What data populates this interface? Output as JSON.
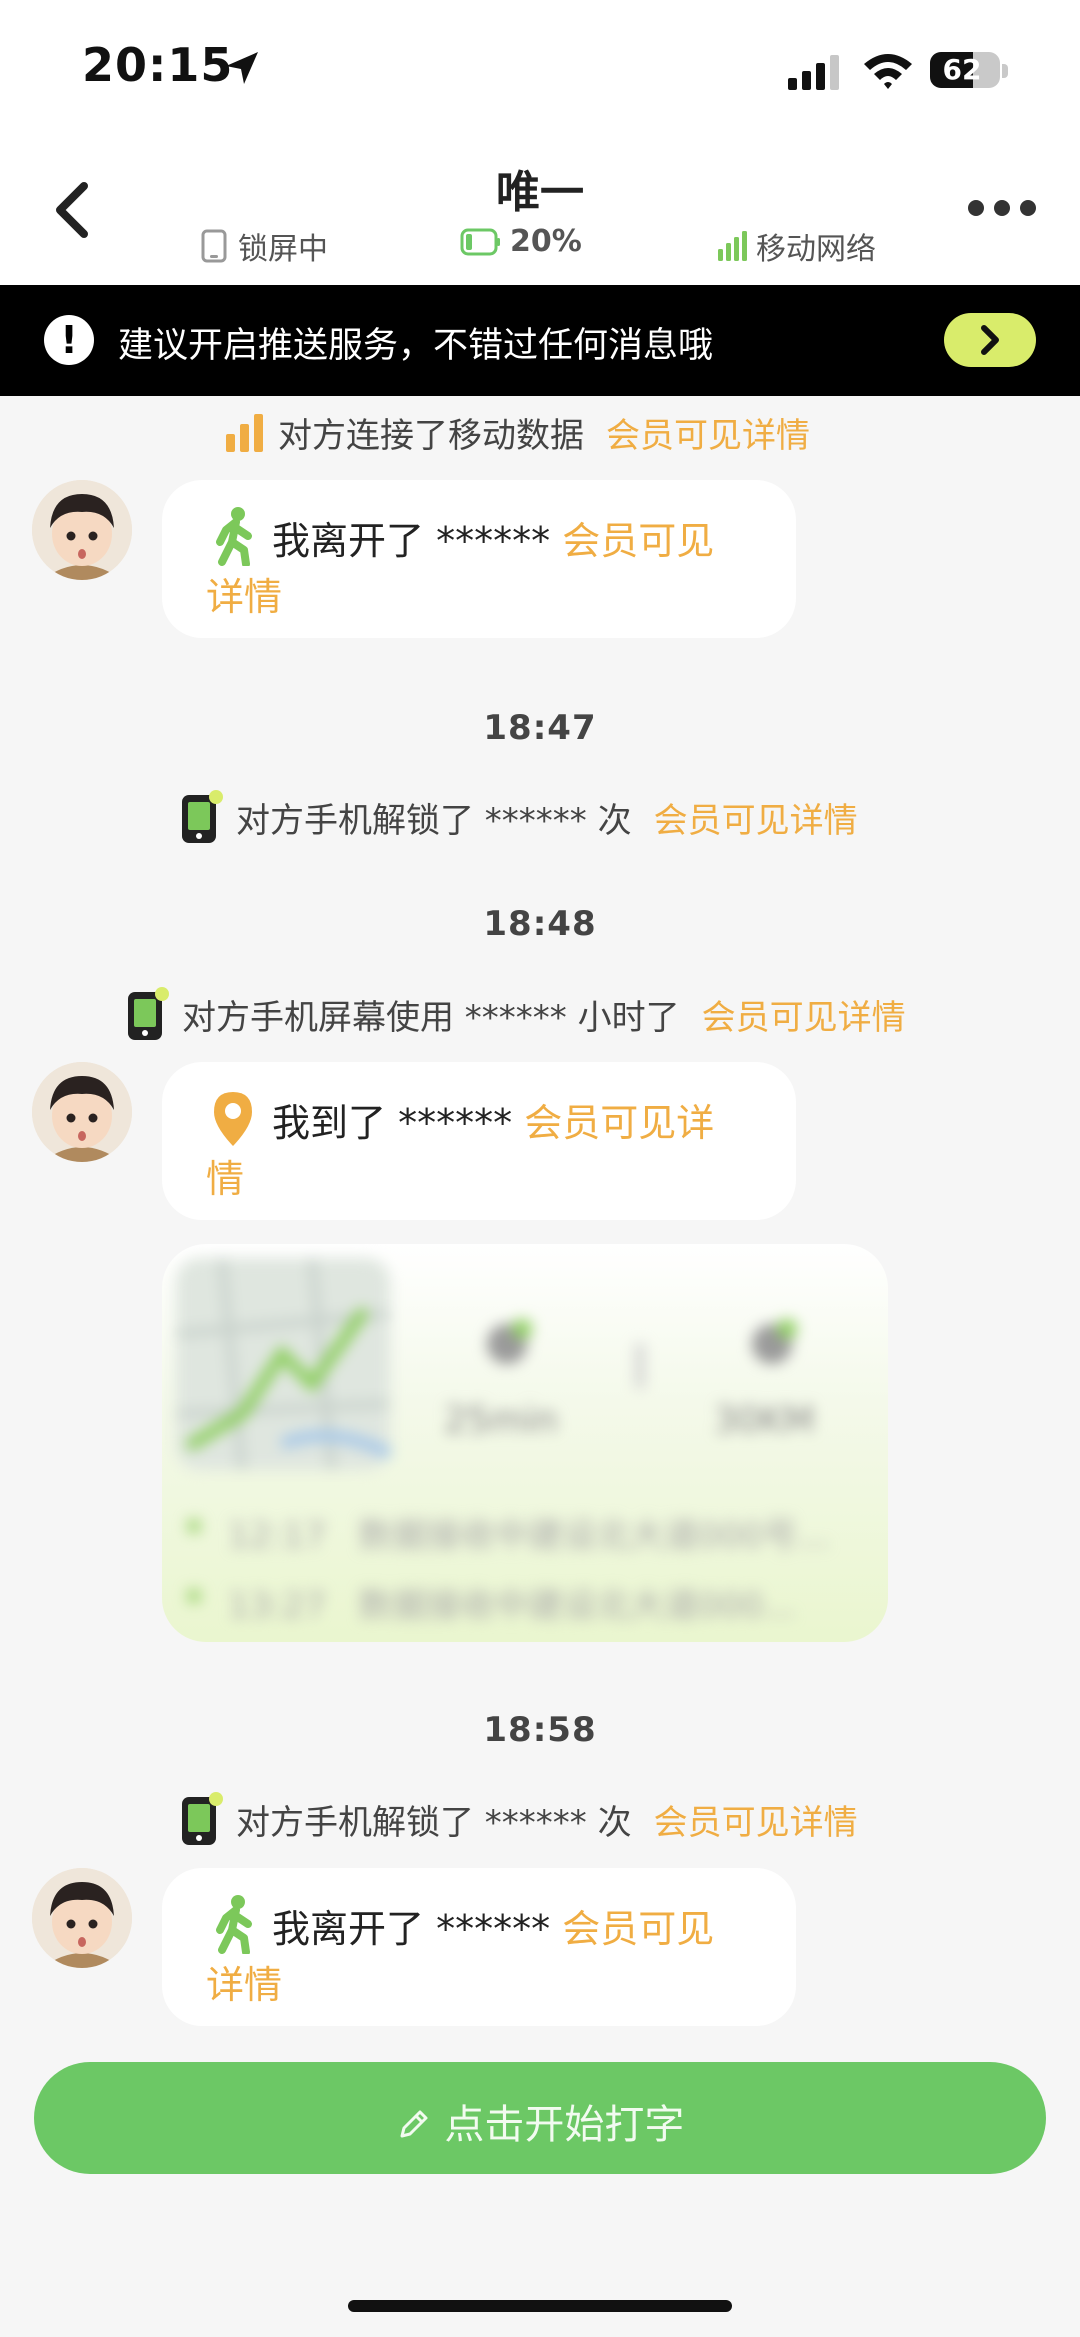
{
  "status_bar": {
    "time": "20:15",
    "battery": "62",
    "battery_level_percent": 62
  },
  "nav": {
    "title": "唯一",
    "screen_status": "锁屏中",
    "battery": "20%",
    "network": "移动网络"
  },
  "banner": {
    "text": "建议开启推送服务，不错过任何消息哦"
  },
  "messages": {
    "sys1": {
      "text": "对方连接了移动数据",
      "vip": "会员可见详情"
    },
    "bubble1": {
      "text": "我离开了 ******",
      "vip_a": "会员可见",
      "vip_b": "详情"
    },
    "time1": "18:47",
    "sys2": {
      "text": "对方手机解锁了 ****** 次",
      "vip": "会员可见详情"
    },
    "time2": "18:48",
    "sys3": {
      "text": "对方手机屏幕使用 ****** 小时了",
      "vip": "会员可见详情"
    },
    "bubble2": {
      "text": "我到了 ******",
      "vip_a": "会员可见详",
      "vip_b": "情"
    },
    "card": {
      "duration": "25min",
      "distance": "30KM",
      "item1_time": "12:17",
      "item1_text": "数据接收中建设北大道000号...",
      "item2_time": "13:27",
      "item2_text": "数据接收中建设北大道000..."
    },
    "time3": "18:58",
    "sys4": {
      "text": "对方手机解锁了 ****** 次",
      "vip": "会员可见详情"
    },
    "bubble3": {
      "text": "我离开了 ******",
      "vip_a": "会员可见",
      "vip_b": "详情"
    }
  },
  "input": {
    "label": "点击开始打字"
  },
  "icons": {
    "location": "location-arrow-icon",
    "signal": "cellular-signal-icon",
    "wifi": "wifi-icon",
    "walk": "walking-person-icon",
    "pin": "map-pin-icon",
    "phone": "phone-icon",
    "bars": "signal-bars-icon",
    "pencil": "pencil-icon"
  },
  "colors": {
    "accent_orange": "#f0ad43",
    "green": "#6cc865",
    "walk_green": "#7cc85a",
    "banner_bg": "#000000",
    "banner_button": "#d9ec6b"
  }
}
